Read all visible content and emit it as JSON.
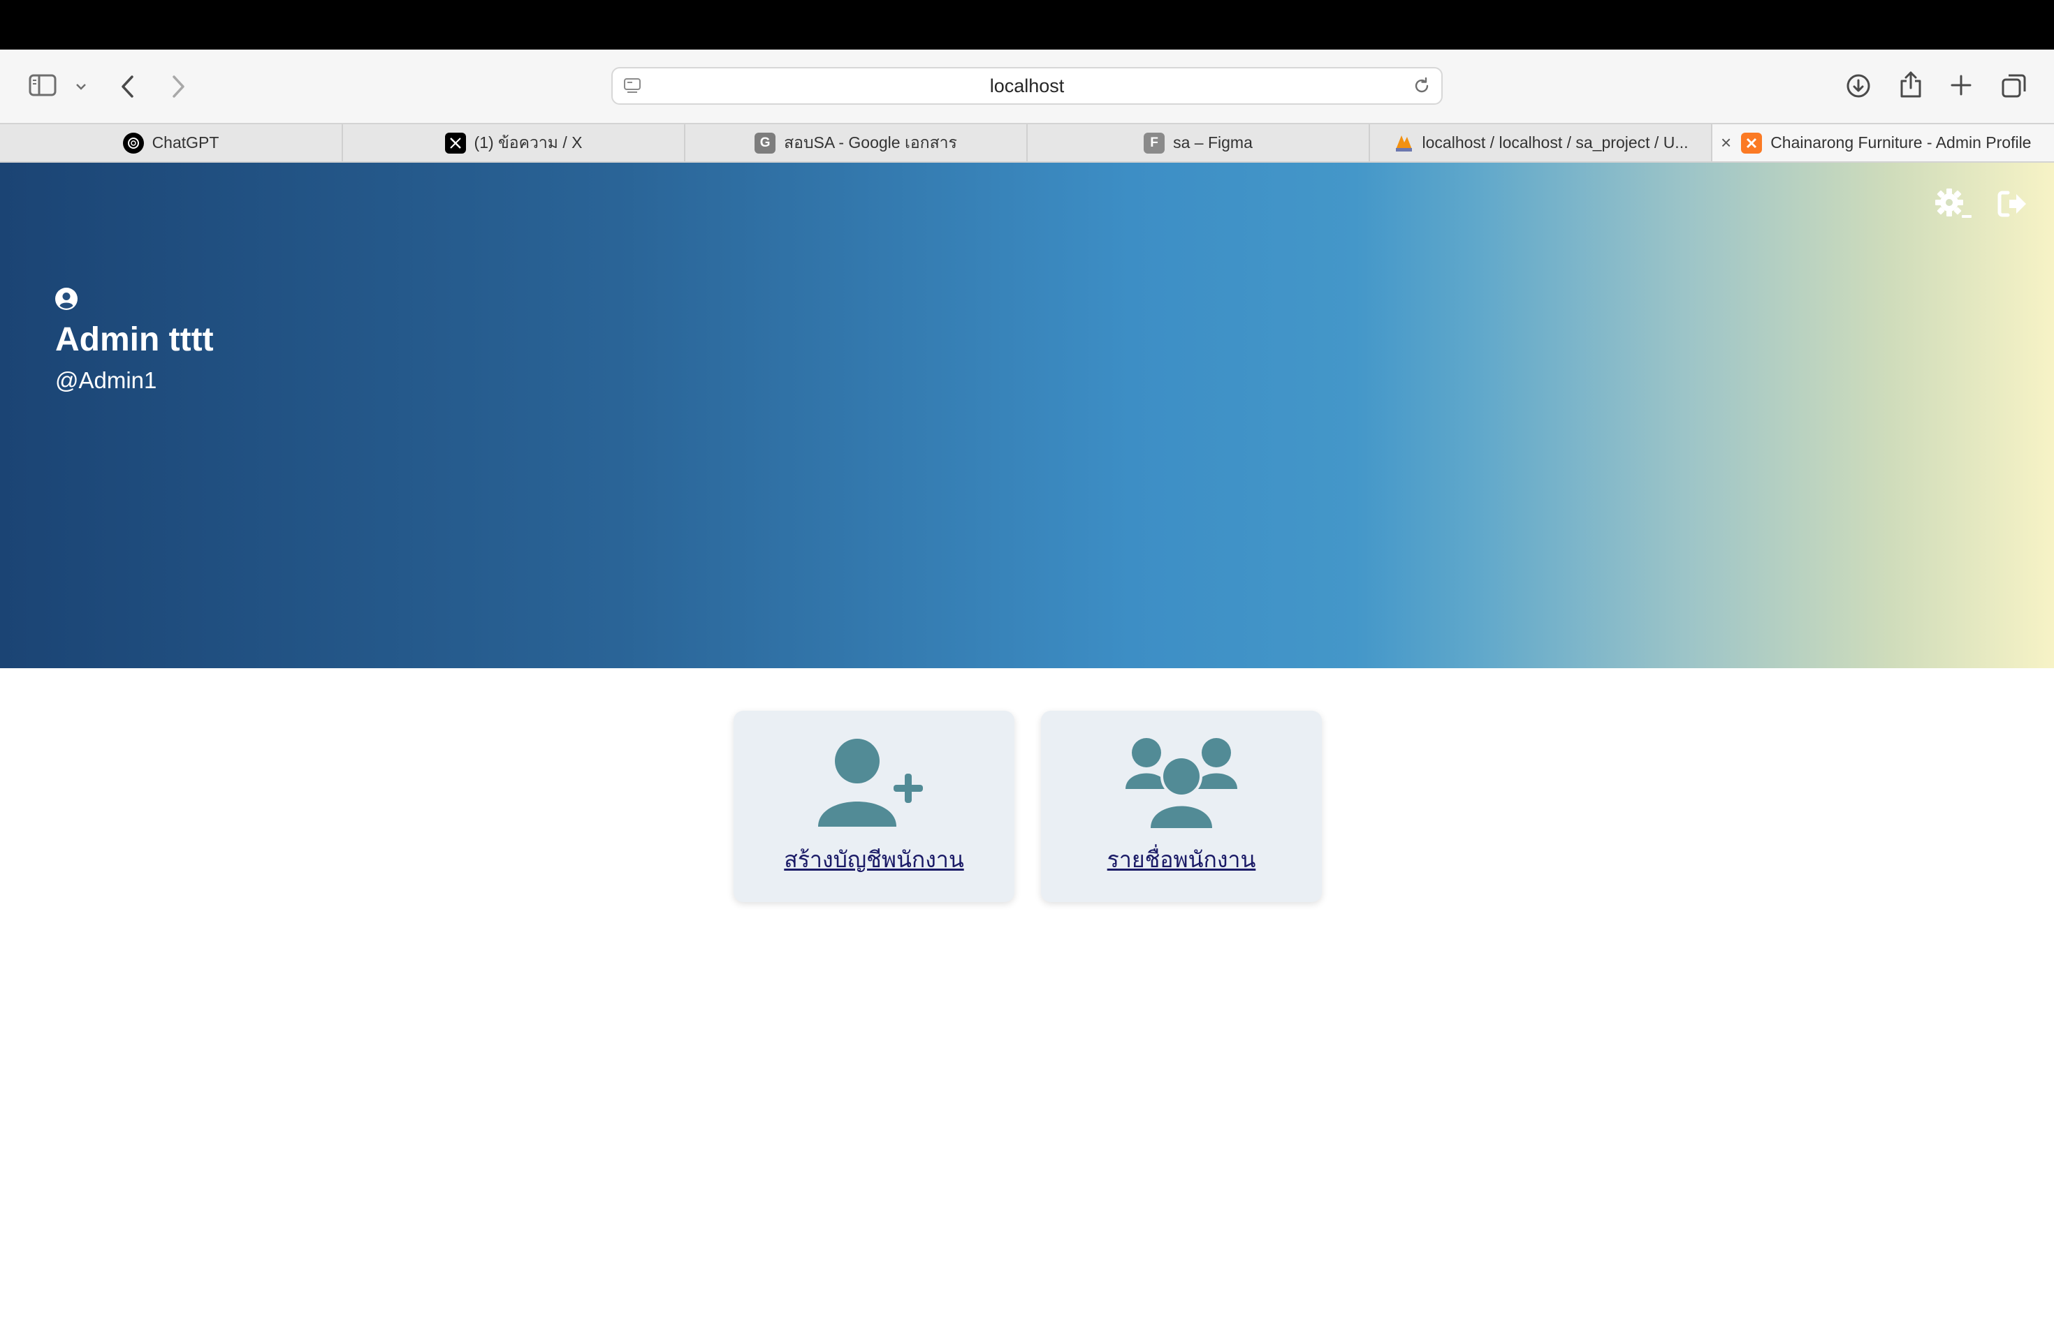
{
  "browser": {
    "url": "localhost",
    "tabs": [
      {
        "title": "ChatGPT",
        "favicon": "chatgpt-icon"
      },
      {
        "title": "(1) ข้อความ / X",
        "favicon": "x-icon"
      },
      {
        "title": "สอบSA - Google เอกสาร",
        "favicon": "google-docs-icon",
        "favicon_letter": "G"
      },
      {
        "title": "sa – Figma",
        "favicon": "figma-icon",
        "favicon_letter": "F"
      },
      {
        "title": "localhost / localhost / sa_project / U...",
        "favicon": "phpmyadmin-icon"
      },
      {
        "title": "Chainarong Furniture - Admin Profile",
        "favicon": "xampp-icon",
        "active": true
      }
    ]
  },
  "profile": {
    "name": "Admin tttt",
    "handle": "@Admin1"
  },
  "actions": [
    {
      "label": "สร้างบัญชีพนักงาน",
      "icon": "user-plus-icon"
    },
    {
      "label": "รายชื่อพนักงาน",
      "icon": "users-icon"
    }
  ],
  "colors": {
    "hero_start": "#1b4474",
    "hero_mid": "#4497c9",
    "hero_end": "#f7f3c6",
    "card_bg": "#eaeff4",
    "icon_teal": "#528b96",
    "link": "#1a1a66"
  }
}
